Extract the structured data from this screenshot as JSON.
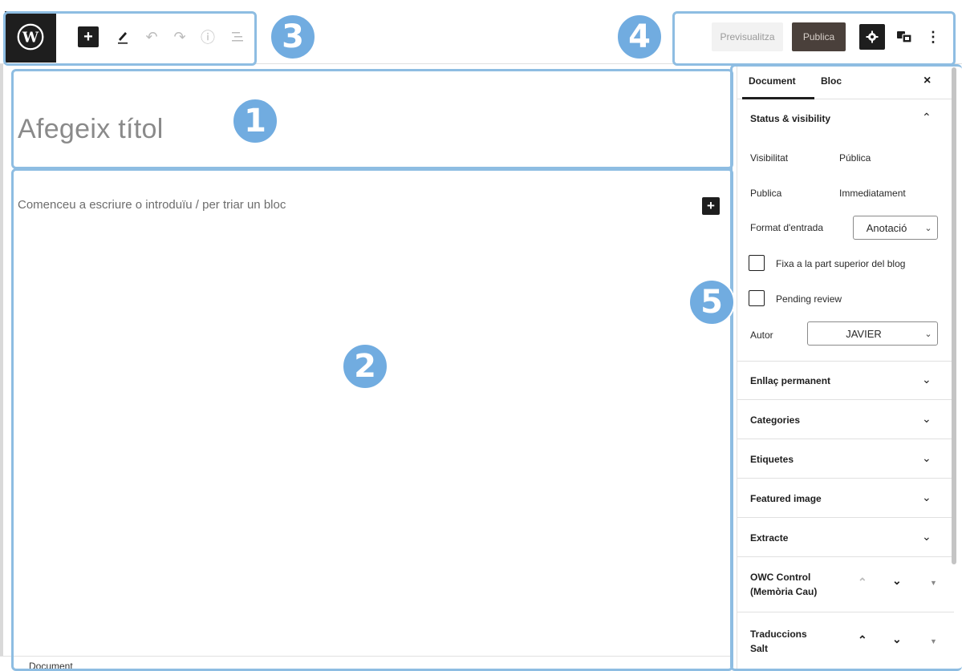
{
  "toolbar": {
    "logo_icon": "wordpress-logo-icon",
    "add_block_icon": "plus-icon",
    "tools_icon": "pencil-icon",
    "undo_icon": "undo-icon",
    "redo_icon": "redo-icon",
    "info_icon": "info-icon",
    "outline_icon": "list-view-icon",
    "preview_label": "Previsualitza",
    "publish_label": "Publica",
    "settings_icon": "gear-icon",
    "translate_icon": "translate-icon",
    "more_icon": "more-vertical-icon"
  },
  "markers": [
    "1",
    "2",
    "3",
    "4",
    "5"
  ],
  "editor": {
    "title_placeholder": "Afegeix títol",
    "body_placeholder": "Comenceu a escriure o introduïu / per triar un bloc",
    "footer_label": "Document"
  },
  "sidebar": {
    "tab_document": "Document",
    "tab_block": "Bloc",
    "close_label": "×",
    "status_panel": {
      "title": "Status & visibility",
      "visibility_label": "Visibilitat",
      "visibility_value": "Pública",
      "publish_label": "Publica",
      "publish_value": "Immediatament",
      "format_label": "Format d'entrada",
      "format_value": "Anotació",
      "sticky_label": "Fixa a la part superior del blog",
      "pending_label": "Pending review",
      "author_label": "Autor",
      "author_value": "JAVIER"
    },
    "panels": [
      {
        "title": "Enllaç permanent"
      },
      {
        "title": "Categories"
      },
      {
        "title": "Etiquetes"
      },
      {
        "title": "Featured image"
      },
      {
        "title": "Extracte"
      }
    ],
    "meta_boxes": [
      {
        "title_line1": "OWC Control",
        "title_line2": "(Memòria Cau)"
      },
      {
        "title_line1": "Traduccions",
        "title_line2": "Salt"
      }
    ]
  },
  "colors": {
    "annotation": "#71ace0",
    "annotation_frame": "#8ebde2",
    "dark": "#1e1e1e",
    "publish_bg": "#4a403b"
  }
}
